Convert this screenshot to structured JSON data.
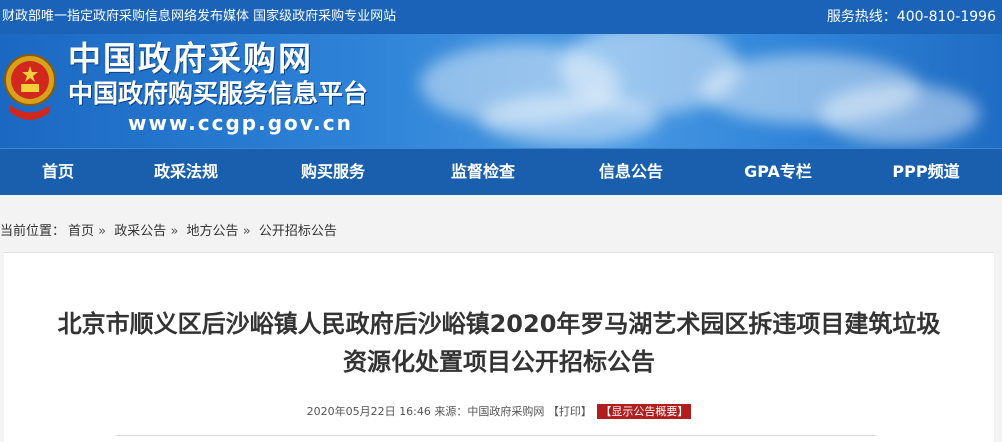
{
  "topbar": {
    "left_text": "财政部唯一指定政府采购信息网络发布媒体 国家级政府采购专业网站",
    "hotline": "服务热线：400-810-1996"
  },
  "banner": {
    "site_name": "中国政府采购网",
    "platform_name": "中国政府购买服务信息平台",
    "url": "www.ccgp.gov.cn"
  },
  "nav": {
    "items": [
      {
        "label": "首页"
      },
      {
        "label": "政采法规"
      },
      {
        "label": "购买服务"
      },
      {
        "label": "监督检查"
      },
      {
        "label": "信息公告"
      },
      {
        "label": "GPA专栏"
      },
      {
        "label": "PPP频道"
      }
    ]
  },
  "breadcrumb": {
    "prefix": "当前位置：",
    "items": [
      "首页",
      "政采公告",
      "地方公告",
      "公开招标公告"
    ],
    "separator": "»"
  },
  "article": {
    "title_line1": "北京市顺义区后沙峪镇人民政府后沙峪镇2020年罗马湖艺术园区拆违项目建筑垃圾",
    "title_line2": "资源化处置项目公开招标公告",
    "date": "2020年05月22日 16:46",
    "source_label": "来源：",
    "source": "中国政府采购网",
    "print": "【打印】",
    "summary_button": "【显示公告概要】"
  },
  "colors": {
    "topbar_bg": "#1a63b9",
    "nav_bg": "#1a5fae",
    "badge_bg": "#b01e1e"
  }
}
